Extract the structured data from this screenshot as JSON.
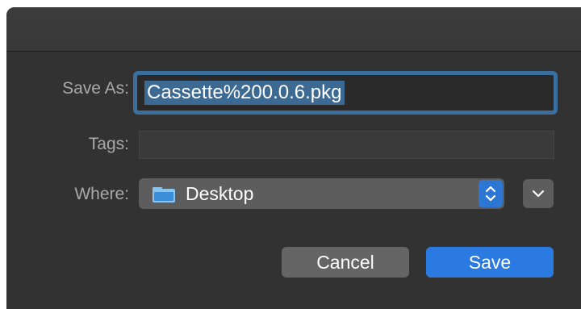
{
  "dialog": {
    "save_as_label": "Save As:",
    "filename": "Cassette%200.0.6.pkg",
    "tags_label": "Tags:",
    "tags_value": "",
    "where_label": "Where:",
    "where_value": "Desktop",
    "cancel_label": "Cancel",
    "save_label": "Save"
  },
  "icons": {
    "folder": "folder-icon",
    "stepper": "chevron-up-down-icon",
    "expand": "chevron-down-icon"
  },
  "colors": {
    "background": "#323232",
    "focus_ring": "#3a6f9d",
    "accent": "#2a7ae2",
    "selection": "#3c6a92"
  }
}
